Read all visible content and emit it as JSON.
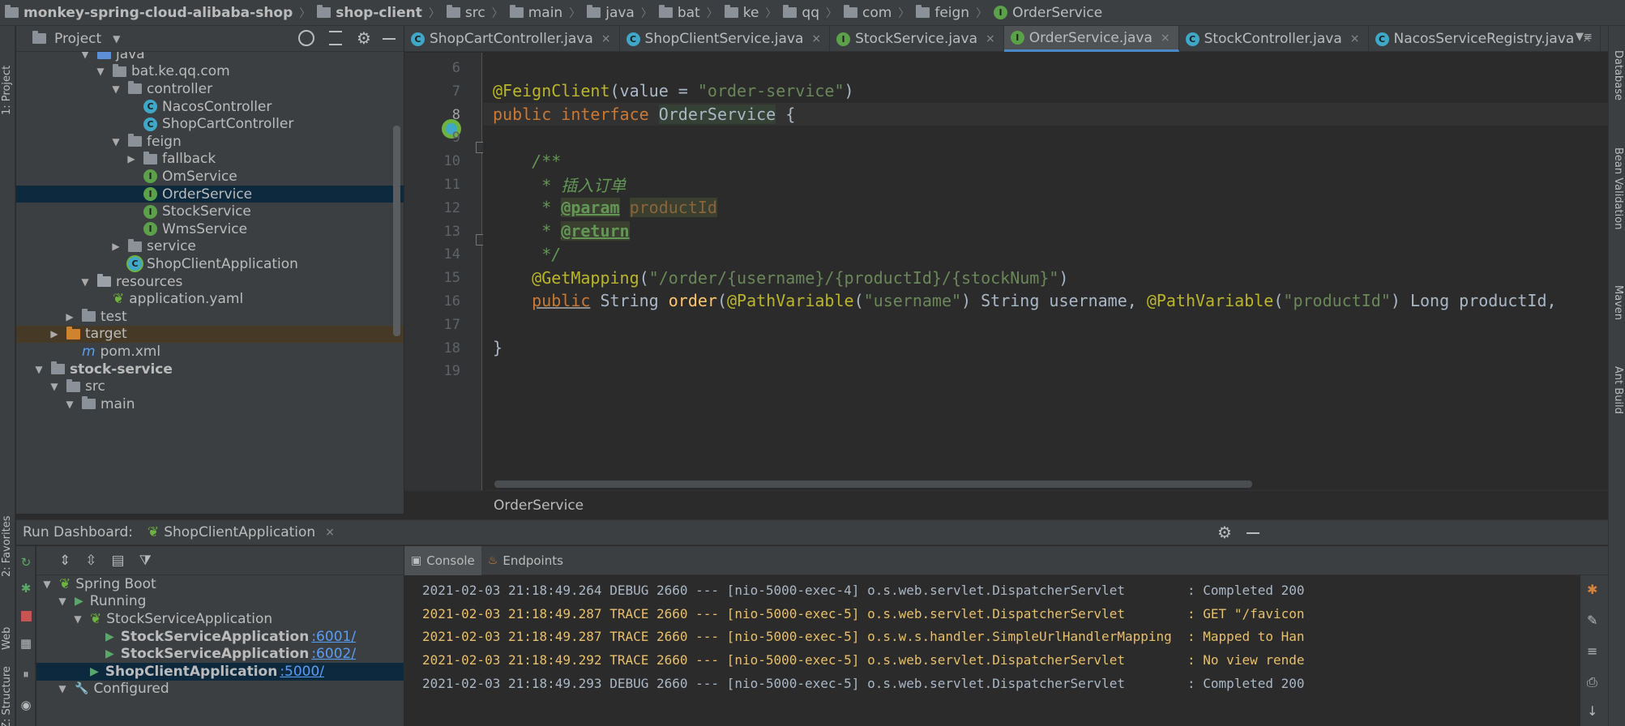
{
  "breadcrumb": [
    {
      "label": "monkey-spring-cloud-alibaba-shop",
      "icon": "module-folder-icon",
      "bold": true
    },
    {
      "label": "shop-client",
      "icon": "module-folder-icon",
      "bold": true
    },
    {
      "label": "src",
      "icon": "folder-icon"
    },
    {
      "label": "main",
      "icon": "folder-icon"
    },
    {
      "label": "java",
      "icon": "folder-icon"
    },
    {
      "label": "bat",
      "icon": "folder-icon"
    },
    {
      "label": "ke",
      "icon": "folder-icon"
    },
    {
      "label": "qq",
      "icon": "folder-icon"
    },
    {
      "label": "com",
      "icon": "folder-icon"
    },
    {
      "label": "feign",
      "icon": "folder-icon"
    },
    {
      "label": "OrderService",
      "icon": "interface-icon"
    }
  ],
  "left_strip": {
    "project": "1: Project",
    "favorites": "2: Favorites",
    "web": "Web",
    "structure": "Z: Structure"
  },
  "right_strip": {
    "database": "Database",
    "bean_validation": "Bean Validation",
    "maven": "Maven",
    "ant_build": "Ant Build"
  },
  "project_panel": {
    "title": "Project",
    "dropdown_glyph": "▼",
    "tree": [
      {
        "label": "java",
        "indent": 4,
        "arrow": "▼",
        "icon": "folder-blue"
      },
      {
        "label": "bat.ke.qq.com",
        "indent": 5,
        "arrow": "▼",
        "icon": "folder"
      },
      {
        "label": "controller",
        "indent": 6,
        "arrow": "▼",
        "icon": "folder"
      },
      {
        "label": "NacosController",
        "indent": 7,
        "arrow": "",
        "icon": "class"
      },
      {
        "label": "ShopCartController",
        "indent": 7,
        "arrow": "",
        "icon": "class"
      },
      {
        "label": "feign",
        "indent": 6,
        "arrow": "▼",
        "icon": "folder"
      },
      {
        "label": "fallback",
        "indent": 7,
        "arrow": "▶",
        "icon": "folder"
      },
      {
        "label": "OmService",
        "indent": 7,
        "arrow": "",
        "icon": "interface"
      },
      {
        "label": "OrderService",
        "indent": 7,
        "arrow": "",
        "icon": "interface",
        "selected": true
      },
      {
        "label": "StockService",
        "indent": 7,
        "arrow": "",
        "icon": "interface"
      },
      {
        "label": "WmsService",
        "indent": 7,
        "arrow": "",
        "icon": "interface"
      },
      {
        "label": "service",
        "indent": 6,
        "arrow": "▶",
        "icon": "folder"
      },
      {
        "label": "ShopClientApplication",
        "indent": 6,
        "arrow": "",
        "icon": "spring-class"
      },
      {
        "label": "resources",
        "indent": 4,
        "arrow": "▼",
        "icon": "folder-gray"
      },
      {
        "label": "application.yaml",
        "indent": 5,
        "arrow": "",
        "icon": "yaml"
      },
      {
        "label": "test",
        "indent": 3,
        "arrow": "▶",
        "icon": "folder"
      },
      {
        "label": "target",
        "indent": 2,
        "arrow": "▶",
        "icon": "folder-orange",
        "highlight": true
      },
      {
        "label": "pom.xml",
        "indent": 3,
        "arrow": "",
        "icon": "maven"
      },
      {
        "label": "stock-service",
        "indent": 1,
        "arrow": "▼",
        "icon": "module",
        "bold": true
      },
      {
        "label": "src",
        "indent": 2,
        "arrow": "▼",
        "icon": "folder"
      },
      {
        "label": "main",
        "indent": 3,
        "arrow": "▼",
        "icon": "folder"
      }
    ]
  },
  "tabs": [
    {
      "label": "ShopCartController.java",
      "icon": "class"
    },
    {
      "label": "ShopClientService.java",
      "icon": "class"
    },
    {
      "label": "StockService.java",
      "icon": "interface"
    },
    {
      "label": "OrderService.java",
      "icon": "interface",
      "active": true
    },
    {
      "label": "StockController.java",
      "icon": "class"
    },
    {
      "label": "NacosServiceRegistry.java",
      "icon": "class"
    }
  ],
  "tab_close_glyph": "×",
  "editor": {
    "current_line": 8,
    "lines": [
      {
        "n": "6",
        "parts": []
      },
      {
        "n": "7",
        "parts": [
          {
            "t": "@FeignClient",
            "c": "ann"
          },
          {
            "t": "(value = ",
            "c": ""
          },
          {
            "t": "\"order-service\"",
            "c": "str"
          },
          {
            "t": ")",
            "c": ""
          }
        ]
      },
      {
        "n": "8",
        "parts": [
          {
            "t": "public interface ",
            "c": "kw"
          },
          {
            "t": "OrderService",
            "c": "hlname"
          },
          {
            "t": " {",
            "c": ""
          }
        ]
      },
      {
        "n": "9",
        "parts": []
      },
      {
        "n": "10",
        "parts": [
          {
            "t": "    /**",
            "c": "cmt"
          }
        ]
      },
      {
        "n": "11",
        "parts": [
          {
            "t": "     * 插入订单",
            "c": "cmt"
          }
        ]
      },
      {
        "n": "12",
        "parts": [
          {
            "t": "     * ",
            "c": "cmt"
          },
          {
            "t": "@param",
            "c": "tag"
          },
          {
            "t": " ",
            "c": "cmt"
          },
          {
            "t": "productId",
            "c": "param"
          }
        ]
      },
      {
        "n": "13",
        "parts": [
          {
            "t": "     * ",
            "c": "cmt"
          },
          {
            "t": "@return",
            "c": "tag"
          }
        ]
      },
      {
        "n": "14",
        "parts": [
          {
            "t": "     */",
            "c": "cmt"
          }
        ]
      },
      {
        "n": "15",
        "parts": [
          {
            "t": "    ",
            "c": ""
          },
          {
            "t": "@GetMapping",
            "c": "ann"
          },
          {
            "t": "(",
            "c": ""
          },
          {
            "t": "\"/order/{username}/{productId}/{stockNum}\"",
            "c": "str"
          },
          {
            "t": ")",
            "c": ""
          }
        ]
      },
      {
        "n": "16",
        "parts": [
          {
            "t": "    ",
            "c": ""
          },
          {
            "t": "public",
            "c": "kw uline"
          },
          {
            "t": " String ",
            "c": ""
          },
          {
            "t": "order",
            "c": "fn"
          },
          {
            "t": "(",
            "c": ""
          },
          {
            "t": "@PathVariable",
            "c": "ann"
          },
          {
            "t": "(",
            "c": ""
          },
          {
            "t": "\"username\"",
            "c": "str"
          },
          {
            "t": ") String username, ",
            "c": ""
          },
          {
            "t": "@PathVariable",
            "c": "ann"
          },
          {
            "t": "(",
            "c": ""
          },
          {
            "t": "\"productId\"",
            "c": "str"
          },
          {
            "t": ") Long productId,",
            "c": ""
          }
        ]
      },
      {
        "n": "17",
        "parts": []
      },
      {
        "n": "18",
        "parts": [
          {
            "t": "}",
            "c": ""
          }
        ]
      },
      {
        "n": "19",
        "parts": []
      }
    ],
    "footer": "OrderService"
  },
  "run_dashboard": {
    "title": "Run Dashboard:",
    "app_tab": "ShopClientApplication",
    "tree": [
      {
        "label": "Spring Boot",
        "indent": 0,
        "arrow": "▼",
        "icon": "spring"
      },
      {
        "label": "Running",
        "indent": 1,
        "arrow": "▼",
        "icon": "run"
      },
      {
        "label": "StockServiceApplication",
        "indent": 2,
        "arrow": "▼",
        "icon": "spring"
      },
      {
        "label": "StockServiceApplication",
        "port": ":6001/",
        "indent": 3,
        "arrow": "",
        "icon": "run",
        "bold": true
      },
      {
        "label": "StockServiceApplication",
        "port": ":6002/",
        "indent": 3,
        "arrow": "",
        "icon": "run",
        "bold": true
      },
      {
        "label": "ShopClientApplication",
        "port": ":5000/",
        "indent": 2,
        "arrow": "",
        "icon": "run",
        "bold": true,
        "selected": true
      },
      {
        "label": "Configured",
        "indent": 1,
        "arrow": "▼",
        "icon": "wrench"
      }
    ],
    "console_tabs": [
      {
        "label": "Console",
        "active": true
      },
      {
        "label": "Endpoints"
      }
    ],
    "logs": [
      {
        "text": "2021-02-03 21:18:49.264 DEBUG 2660 --- [nio-5000-exec-4] o.s.web.servlet.DispatcherServlet        : Completed 200",
        "level": "debug"
      },
      {
        "text": "2021-02-03 21:18:49.287 TRACE 2660 --- [nio-5000-exec-5] o.s.web.servlet.DispatcherServlet        : GET \"/favicon",
        "level": "trace"
      },
      {
        "text": "2021-02-03 21:18:49.287 TRACE 2660 --- [nio-5000-exec-5] o.s.w.s.handler.SimpleUrlHandlerMapping  : Mapped to Han",
        "level": "trace"
      },
      {
        "text": "2021-02-03 21:18:49.292 TRACE 2660 --- [nio-5000-exec-5] o.s.web.servlet.DispatcherServlet        : No view rende",
        "level": "trace"
      },
      {
        "text": "2021-02-03 21:18:49.293 DEBUG 2660 --- [nio-5000-exec-5] o.s.web.servlet.DispatcherServlet        : Completed 200",
        "level": "debug"
      }
    ]
  },
  "colors": {
    "accent": "#4a88c7",
    "selection": "#0d293e",
    "spring_green": "#6db33f"
  }
}
